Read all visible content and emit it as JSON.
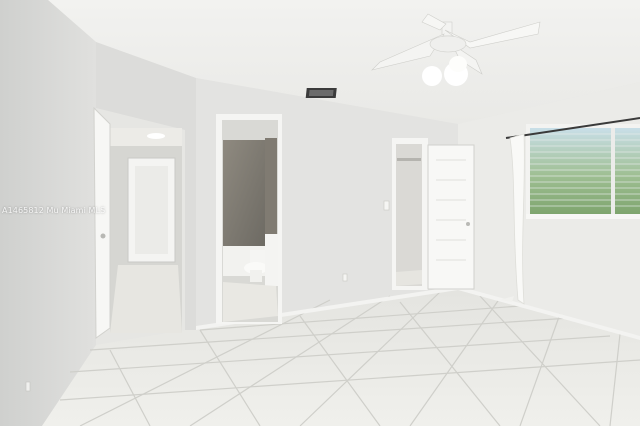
{
  "photo": {
    "watermark": "A1465812 Mu Miami MLS"
  }
}
